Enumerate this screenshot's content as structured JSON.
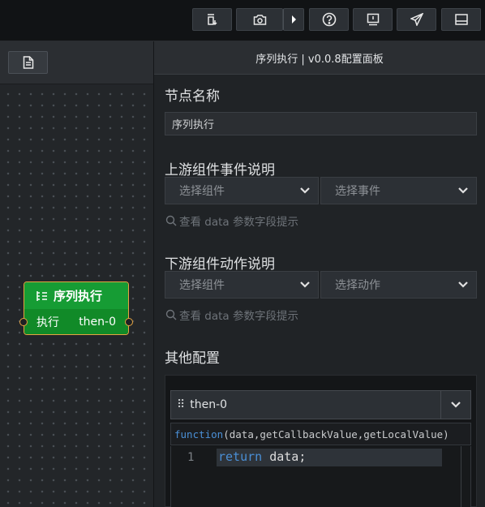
{
  "toolbar": {
    "buttons": [
      {
        "icon": "export-icon"
      },
      {
        "icon": "camera-icon"
      },
      {
        "icon": "chevron-right-icon"
      },
      {
        "icon": "help-icon"
      },
      {
        "icon": "alert-icon"
      },
      {
        "icon": "send-icon"
      },
      {
        "icon": "panel-icon"
      }
    ]
  },
  "canvas": {
    "node": {
      "title": "序列执行",
      "input_label": "执行",
      "output_label": "then-0",
      "header_color": "#169c34",
      "border_color": "#e5a341"
    }
  },
  "panel": {
    "title": "序列执行 | v0.0.8配置面板",
    "node_name_section": "节点名称",
    "node_name_value": "序列执行",
    "upstream_section": "上游组件事件说明",
    "upstream_component_placeholder": "选择组件",
    "upstream_event_placeholder": "选择事件",
    "upstream_hint": "查看 data 参数字段提示",
    "downstream_section": "下游组件动作说明",
    "downstream_component_placeholder": "选择组件",
    "downstream_action_placeholder": "选择动作",
    "downstream_hint": "查看 data 参数字段提示",
    "other_section": "其他配置",
    "function_name": "then-0",
    "signature_keyword": "function",
    "signature_params": " (data,getCallbackValue,getLocalValue)",
    "code_line_number": "1",
    "code_keyword": "return",
    "code_rest": " data;"
  }
}
